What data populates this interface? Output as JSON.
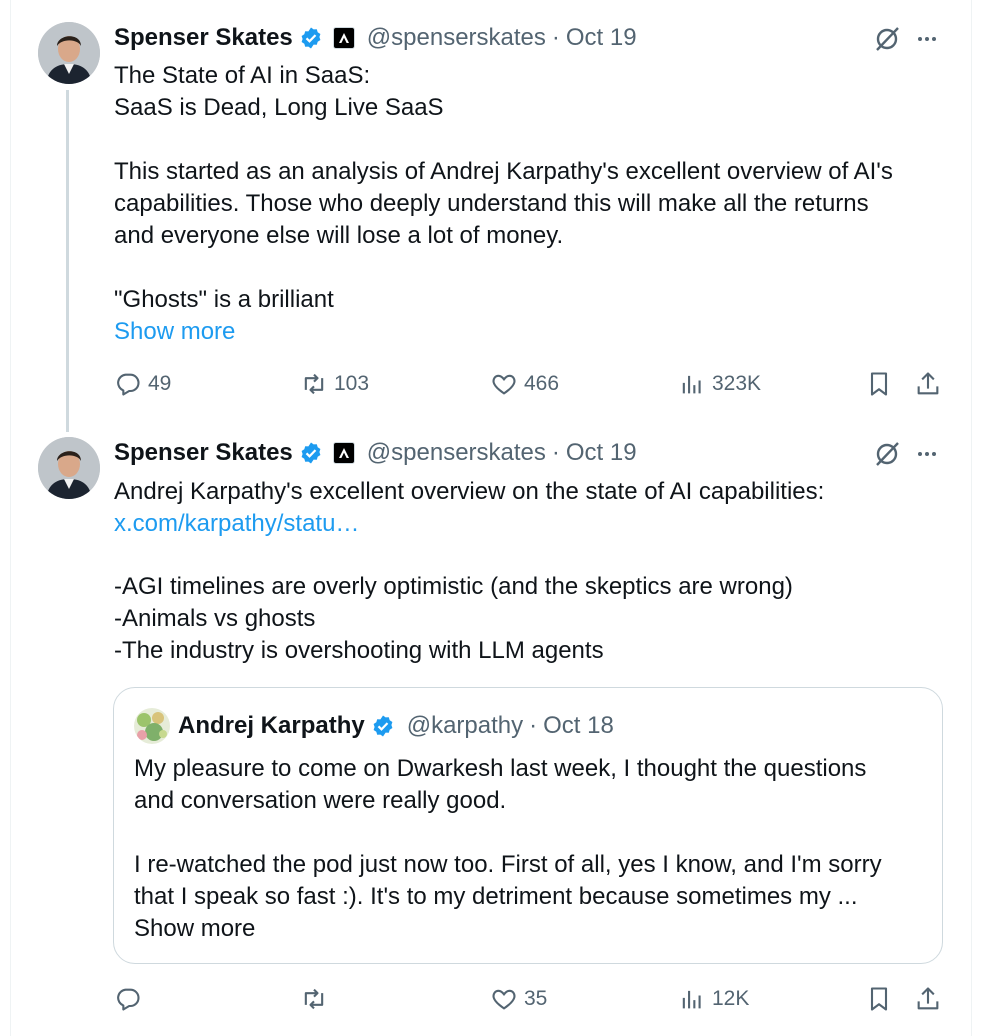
{
  "tweets": [
    {
      "author_name": "Spenser Skates",
      "handle": "@spenserskates",
      "separator": "·",
      "date": "Oct 19",
      "lines": [
        "The State of AI in SaaS:",
        "SaaS is Dead, Long Live SaaS",
        "This started as an analysis of Andrej Karpathy's excellent overview of AI's",
        "capabilities. Those who deeply understand this will make all the returns",
        "and everyone else will lose a lot of money.",
        "\"Ghosts\" is a brilliant"
      ],
      "show_more": "Show more",
      "actions": {
        "replies": "49",
        "reposts": "103",
        "likes": "466",
        "views": "323K"
      }
    },
    {
      "author_name": "Spenser Skates",
      "handle": "@spenserskates",
      "separator": "·",
      "date": "Oct 19",
      "lines": [
        "Andrej Karpathy's excellent overview on the state of AI capabilities:",
        "x.com/karpathy/statu…",
        "-AGI timelines are overly optimistic (and the skeptics are wrong)",
        "-Animals vs ghosts",
        "-The industry is overshooting with LLM agents"
      ],
      "actions": {
        "replies": "",
        "reposts": "",
        "likes": "35",
        "views": "12K"
      },
      "quote": {
        "author_name": "Andrej Karpathy",
        "handle": "@karpathy",
        "separator": "·",
        "date": "Oct 18",
        "lines": [
          "My pleasure to come on Dwarkesh last week, I thought the questions",
          "and conversation were really good.",
          "I re-watched the pod just now too. First of all, yes I know, and I'm sorry",
          "that I speak so fast :). It's to my detriment because sometimes my ..."
        ],
        "show_more": "Show more"
      }
    }
  ],
  "colors": {
    "text": "#0f1419",
    "secondary": "#536471",
    "link": "#1d9bf0",
    "verified": "#1d9bf0",
    "border": "#cfd9de"
  },
  "icons": [
    "verified-badge-icon",
    "affiliate-badge-icon",
    "grok-icon",
    "more-icon",
    "reply-icon",
    "repost-icon",
    "like-icon",
    "views-icon",
    "bookmark-icon",
    "share-icon"
  ]
}
